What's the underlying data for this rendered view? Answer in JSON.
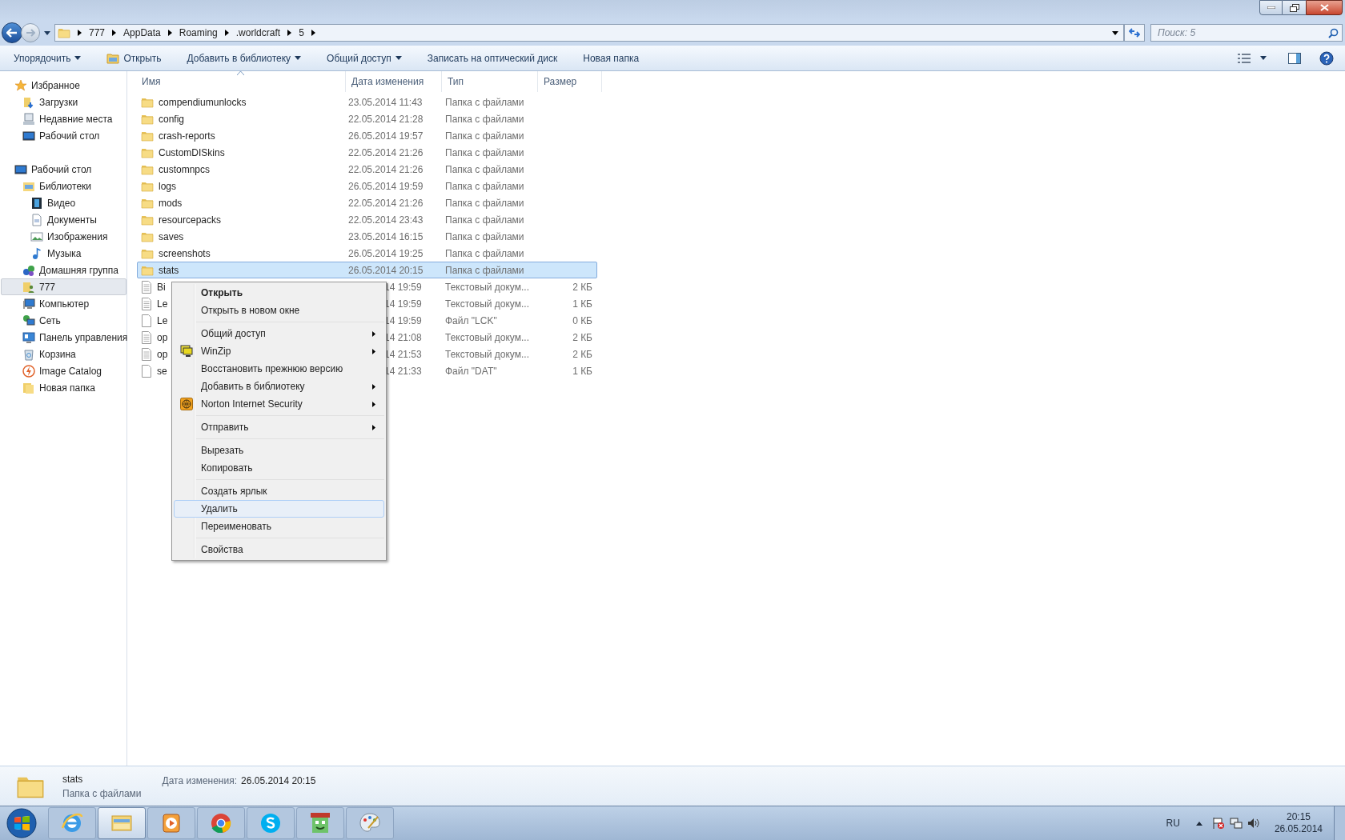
{
  "address": {
    "crumbs": [
      "777",
      "AppData",
      "Roaming",
      ".worldcraft",
      "5"
    ]
  },
  "search": {
    "placeholder": "Поиск: 5"
  },
  "toolbar": {
    "buttons": [
      {
        "label": "Упорядочить",
        "dropdown": true,
        "kind": "plain"
      },
      {
        "label": "Открыть",
        "dropdown": false,
        "kind": "open"
      },
      {
        "label": "Добавить в библиотеку",
        "dropdown": true,
        "kind": "plain"
      },
      {
        "label": "Общий доступ",
        "dropdown": true,
        "kind": "plain"
      },
      {
        "label": "Записать на оптический диск",
        "dropdown": false,
        "kind": "plain"
      },
      {
        "label": "Новая папка",
        "dropdown": false,
        "kind": "plain"
      }
    ]
  },
  "sidebar": {
    "groups": [
      [
        {
          "label": "Избранное",
          "kind": "star",
          "selected": false,
          "children": [
            {
              "label": "Загрузки",
              "kind": "downloads",
              "selected": false
            },
            {
              "label": "Недавние места",
              "kind": "recent",
              "selected": false
            },
            {
              "label": "Рабочий стол",
              "kind": "desktop",
              "selected": false
            }
          ]
        }
      ],
      [
        {
          "label": "Рабочий стол",
          "kind": "desktop",
          "selected": false,
          "children": [
            {
              "label": "Библиотеки",
              "kind": "library",
              "selected": false,
              "children": [
                {
                  "label": "Видео",
                  "kind": "video",
                  "selected": false
                },
                {
                  "label": "Документы",
                  "kind": "document",
                  "selected": false
                },
                {
                  "label": "Изображения",
                  "kind": "image",
                  "selected": false
                },
                {
                  "label": "Музыка",
                  "kind": "music",
                  "selected": false
                }
              ]
            },
            {
              "label": "Домашняя группа",
              "kind": "homegroup",
              "selected": false
            },
            {
              "label": "777",
              "kind": "userfolder",
              "selected": true
            },
            {
              "label": "Компьютер",
              "kind": "computer",
              "selected": false
            },
            {
              "label": "Сеть",
              "kind": "network",
              "selected": false
            },
            {
              "label": "Панель управления",
              "kind": "controlpanel",
              "selected": false
            },
            {
              "label": "Корзина",
              "kind": "recycle",
              "selected": false
            },
            {
              "label": "Image Catalog",
              "kind": "catalog",
              "selected": false
            },
            {
              "label": "Новая папка",
              "kind": "folder",
              "selected": false
            }
          ]
        }
      ]
    ]
  },
  "table": {
    "columns": [
      "Имя",
      "Дата изменения",
      "Тип",
      "Размер"
    ],
    "rows": [
      {
        "name": "compendiumunlocks",
        "date": "23.05.2014 11:43",
        "type": "Папка с файлами",
        "kind": "folder",
        "selected": false,
        "covered": false
      },
      {
        "name": "config",
        "date": "22.05.2014 21:28",
        "type": "Папка с файлами",
        "kind": "folder",
        "selected": false,
        "covered": false
      },
      {
        "name": "crash-reports",
        "date": "26.05.2014 19:57",
        "type": "Папка с файлами",
        "kind": "folder",
        "selected": false,
        "covered": false
      },
      {
        "name": "CustomDISkins",
        "date": "22.05.2014 21:26",
        "type": "Папка с файлами",
        "kind": "folder",
        "selected": false,
        "covered": false
      },
      {
        "name": "customnpcs",
        "date": "22.05.2014 21:26",
        "type": "Папка с файлами",
        "kind": "folder",
        "selected": false,
        "covered": false
      },
      {
        "name": "logs",
        "date": "26.05.2014 19:59",
        "type": "Папка с файлами",
        "kind": "folder",
        "selected": false,
        "covered": false
      },
      {
        "name": "mods",
        "date": "22.05.2014 21:26",
        "type": "Папка с файлами",
        "kind": "folder",
        "selected": false,
        "covered": false
      },
      {
        "name": "resourcepacks",
        "date": "22.05.2014 23:43",
        "type": "Папка с файлами",
        "kind": "folder",
        "selected": false,
        "covered": false
      },
      {
        "name": "saves",
        "date": "23.05.2014 16:15",
        "type": "Папка с файлами",
        "kind": "folder",
        "selected": false,
        "covered": false
      },
      {
        "name": "screenshots",
        "date": "26.05.2014 19:25",
        "type": "Папка с файлами",
        "kind": "folder",
        "selected": false,
        "covered": false
      },
      {
        "name": "stats",
        "date": "26.05.2014 20:15",
        "type": "Папка с файлами",
        "kind": "folder",
        "selected": true,
        "covered": false
      },
      {
        "name": "Bi",
        "date": "14 19:59",
        "type": "Текстовый докум...",
        "size": "2 КБ",
        "kind": "text",
        "selected": false,
        "covered": true
      },
      {
        "name": "Le",
        "date": "14 19:59",
        "type": "Текстовый докум...",
        "size": "1 КБ",
        "kind": "text",
        "selected": false,
        "covered": true
      },
      {
        "name": "Le",
        "date": "14 19:59",
        "type": "Файл \"LCK\"",
        "size": "0 КБ",
        "kind": "file",
        "selected": false,
        "covered": true
      },
      {
        "name": "op",
        "date": "14 21:08",
        "type": "Текстовый докум...",
        "size": "2 КБ",
        "kind": "text",
        "selected": false,
        "covered": true
      },
      {
        "name": "op",
        "date": "14 21:53",
        "type": "Текстовый докум...",
        "size": "2 КБ",
        "kind": "text",
        "selected": false,
        "covered": true
      },
      {
        "name": "se",
        "date": "14 21:33",
        "type": "Файл \"DAT\"",
        "size": "1 КБ",
        "kind": "file",
        "selected": false,
        "covered": true
      }
    ]
  },
  "context_menu": {
    "groups": [
      [
        {
          "label": "Открыть",
          "default": true,
          "submenu": false,
          "kind": "plain",
          "selected": false
        },
        {
          "label": "Открыть в новом окне",
          "default": false,
          "submenu": false,
          "kind": "plain",
          "selected": false
        }
      ],
      [
        {
          "label": "Общий доступ",
          "default": false,
          "submenu": true,
          "kind": "plain",
          "selected": false
        },
        {
          "label": "WinZip",
          "default": false,
          "submenu": true,
          "kind": "winzip",
          "selected": false
        },
        {
          "label": "Восстановить прежнюю версию",
          "default": false,
          "submenu": false,
          "kind": "plain",
          "selected": false
        },
        {
          "label": "Добавить в библиотеку",
          "default": false,
          "submenu": true,
          "kind": "plain",
          "selected": false
        },
        {
          "label": "Norton Internet Security",
          "default": false,
          "submenu": true,
          "kind": "norton",
          "selected": false
        }
      ],
      [
        {
          "label": "Отправить",
          "default": false,
          "submenu": true,
          "kind": "plain",
          "selected": false
        }
      ],
      [
        {
          "label": "Вырезать",
          "default": false,
          "submenu": false,
          "kind": "plain",
          "selected": false
        },
        {
          "label": "Копировать",
          "default": false,
          "submenu": false,
          "kind": "plain",
          "selected": false
        }
      ],
      [
        {
          "label": "Создать ярлык",
          "default": false,
          "submenu": false,
          "kind": "plain",
          "selected": false
        },
        {
          "label": "Удалить",
          "default": false,
          "submenu": false,
          "kind": "plain",
          "selected": true
        },
        {
          "label": "Переименовать",
          "default": false,
          "submenu": false,
          "kind": "plain",
          "selected": false
        }
      ],
      [
        {
          "label": "Свойства",
          "default": false,
          "submenu": false,
          "kind": "plain",
          "selected": false
        }
      ]
    ]
  },
  "details": {
    "name": "stats",
    "type": "Папка с файлами",
    "date_label": "Дата изменения:",
    "date": "26.05.2014 20:15"
  },
  "taskbar": {
    "apps": [
      {
        "kind": "ie",
        "active": false
      },
      {
        "kind": "explorer",
        "active": true
      },
      {
        "kind": "media",
        "active": false
      },
      {
        "kind": "chrome",
        "active": false
      },
      {
        "kind": "skype",
        "active": false
      },
      {
        "kind": "game",
        "active": false
      },
      {
        "kind": "paint",
        "active": false
      }
    ],
    "language": "RU",
    "time": "20:15",
    "date": "26.05.2014"
  }
}
